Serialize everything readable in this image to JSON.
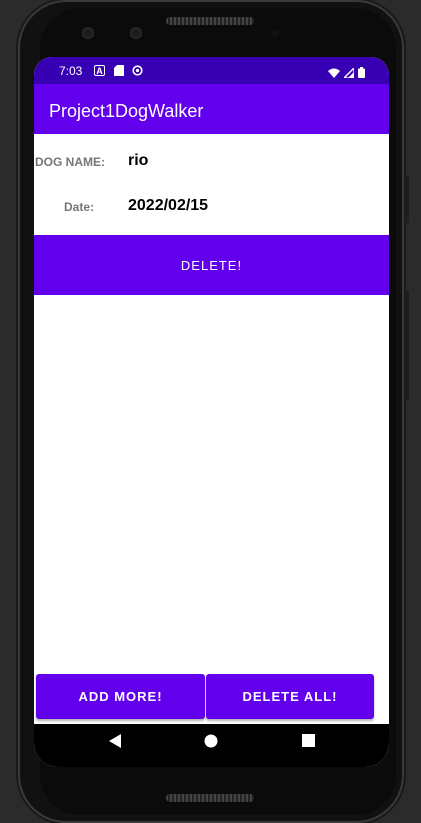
{
  "status": {
    "time": "7:03",
    "left_icons": [
      "A",
      "sd-card-icon",
      "sync-icon"
    ],
    "right_icons": [
      "wifi-icon",
      "signal-icon",
      "battery-icon"
    ]
  },
  "appbar": {
    "title": "Project1DogWalker"
  },
  "form": {
    "dog_name_label": "DOG NAME:",
    "dog_name_value": "rio",
    "date_label": "Date:",
    "date_value": "2022/02/15"
  },
  "buttons": {
    "delete": "DELETE!",
    "add_more": "ADD MORE!",
    "delete_all": "DELETE ALL!"
  },
  "navbar": {
    "items": [
      "back-icon",
      "home-icon",
      "recents-icon"
    ]
  },
  "colors": {
    "status_bar": "#3700b3",
    "primary": "#6200ee"
  }
}
